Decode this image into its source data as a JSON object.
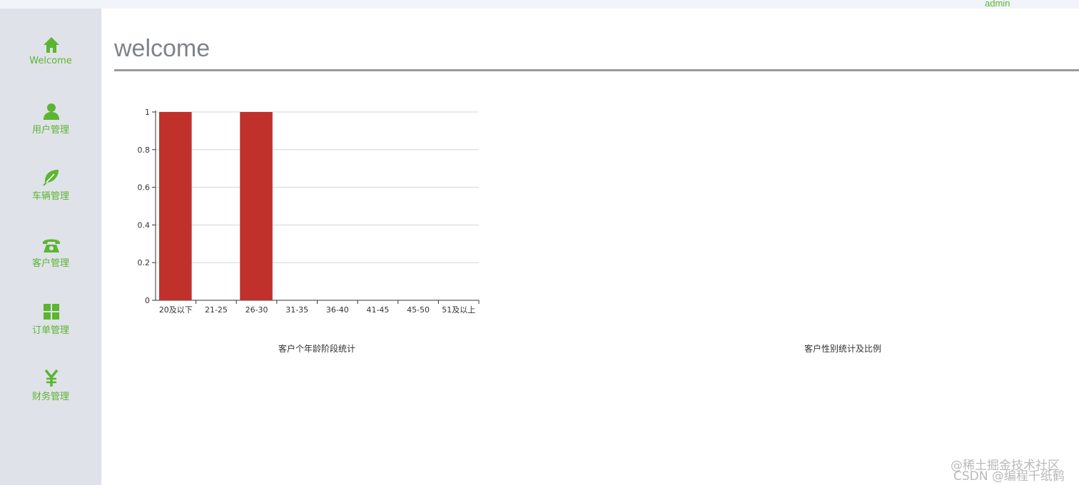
{
  "header": {
    "user": "admin"
  },
  "sidebar": {
    "items": [
      {
        "label": "Welcome",
        "icon": "home-icon"
      },
      {
        "label": "用户管理",
        "icon": "user-icon"
      },
      {
        "label": "车辆管理",
        "icon": "leaf-icon"
      },
      {
        "label": "客户管理",
        "icon": "phone-icon"
      },
      {
        "label": "订单管理",
        "icon": "grid-icon"
      },
      {
        "label": "财务管理",
        "icon": "yen-icon"
      }
    ],
    "accent_color": "#5cb531"
  },
  "main": {
    "title": "welcome",
    "age_chart_caption": "客户个年龄阶段统计",
    "gender_chart_caption": "客户性别统计及比例"
  },
  "chart_data": {
    "type": "bar",
    "categories": [
      "20及以下",
      "21-25",
      "26-30",
      "31-35",
      "36-40",
      "41-45",
      "45-50",
      "51及以上"
    ],
    "values": [
      1,
      0,
      1,
      0,
      0,
      0,
      0,
      0
    ],
    "yticks": [
      "0",
      "0.2",
      "0.4",
      "0.6",
      "0.8",
      "1"
    ],
    "ylim": [
      0,
      1
    ],
    "grid": true,
    "bar_color": "#c1312c",
    "title": "客户个年龄阶段统计"
  },
  "watermark": {
    "line1": "@稀土掘金技术社区",
    "line2": "CSDN @编程千纸鹤"
  }
}
